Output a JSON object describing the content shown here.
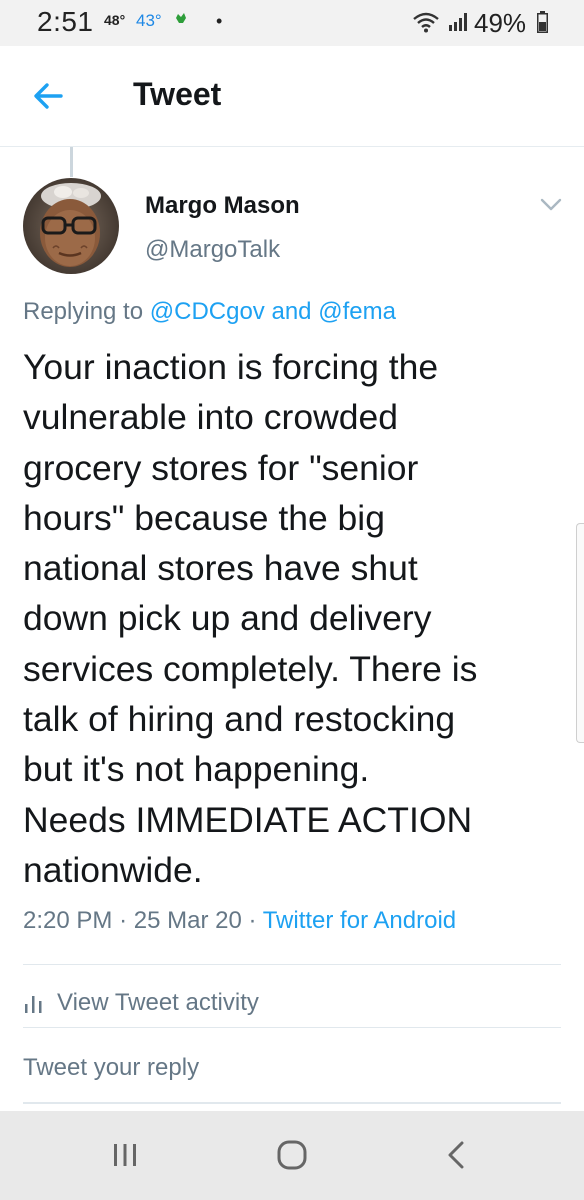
{
  "status_bar": {
    "time": "2:51",
    "temp_1": "48°",
    "temp_2": "43°",
    "battery_percent": "49%"
  },
  "header": {
    "title": "Tweet"
  },
  "tweet": {
    "author_name": "Margo Mason",
    "author_handle": "@MargoTalk",
    "replying_prefix": "Replying to",
    "mention_1": "@CDCgov",
    "mention_joiner": "and",
    "mention_2": "@fema",
    "lines": [
      "Your inaction is forcing the",
      "vulnerable into crowded",
      "grocery stores for \"senior",
      "hours\" because the big",
      "national stores have shut",
      "down pick up and delivery",
      "services completely. There is",
      "talk of hiring and restocking",
      "but it's not happening.",
      "Needs IMMEDIATE ACTION",
      "nationwide."
    ],
    "time": "2:20 PM",
    "date": "25 Mar 20",
    "separator": "·",
    "source": "Twitter for Android"
  },
  "actions": {
    "view_activity": "View Tweet activity",
    "reply_placeholder": "Tweet your reply"
  },
  "icons": {
    "back": "arrow-left-icon",
    "menu": "chevron-down-icon",
    "activity": "bar-chart-icon",
    "nav_recents": "recents-icon",
    "nav_home": "home-icon",
    "nav_back": "nav-back-icon"
  },
  "colors": {
    "accent": "#1da1f2",
    "secondary_text": "#657786",
    "primary_text": "#14171a"
  }
}
